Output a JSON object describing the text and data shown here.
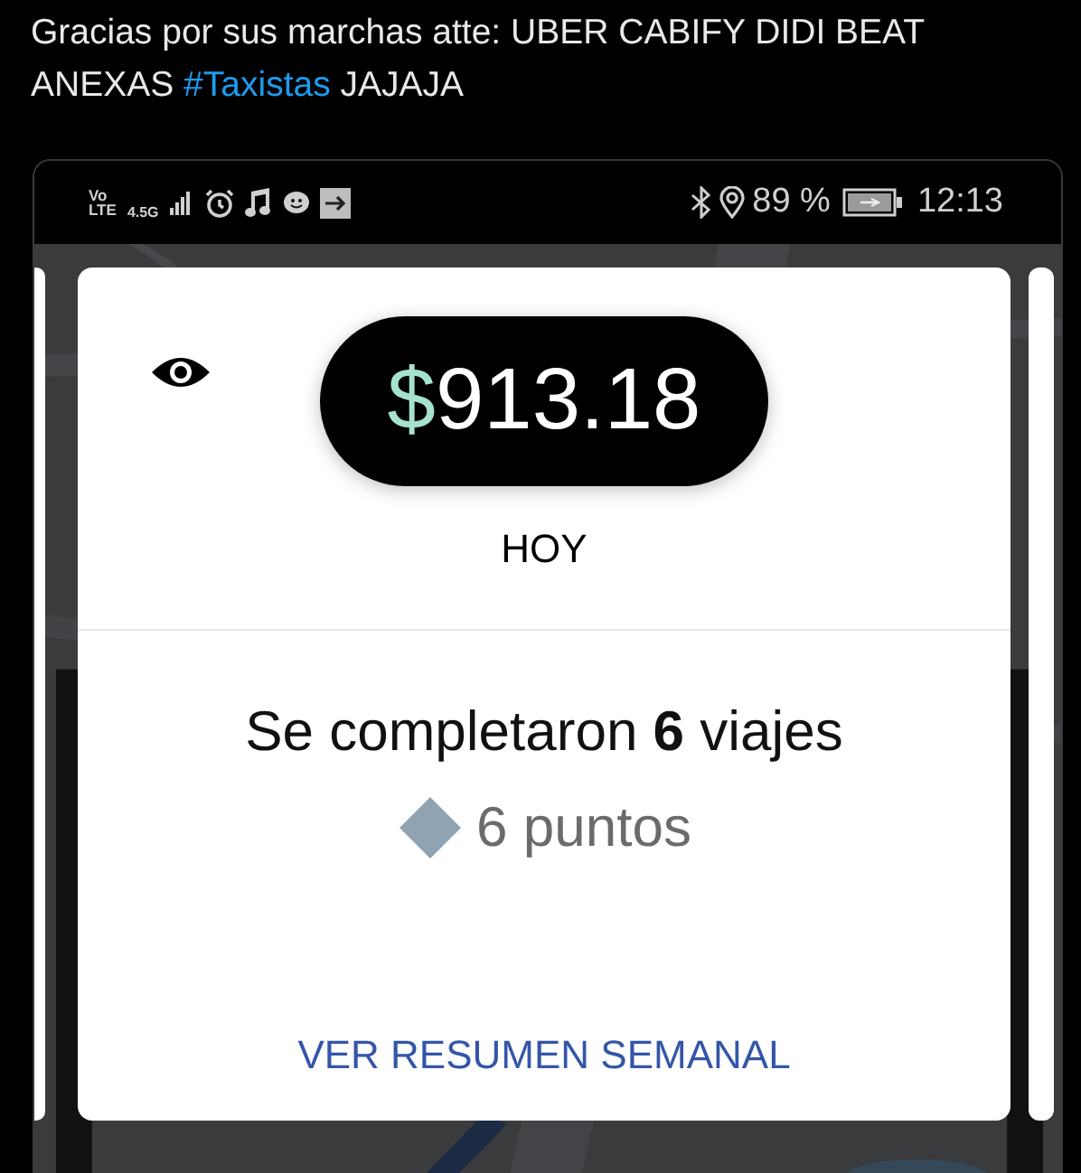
{
  "tweet": {
    "text_before": "Gracias por sus marchas atte: UBER CABIFY DIDI BEAT ANEXAS",
    "hashtag": "#Taxistas",
    "text_after": "JAJAJA"
  },
  "status_bar": {
    "volte_top": "Vo",
    "volte_bottom": "LTE",
    "network": "4.5G",
    "battery": "89 %",
    "time": "12:13"
  },
  "card": {
    "amount": {
      "currency": "$",
      "value": "913.18"
    },
    "period": "HOY",
    "trips": "Se completaron **6** viajes",
    "points": "6 puntos",
    "link": "VER RESUMEN SEMANAL"
  }
}
